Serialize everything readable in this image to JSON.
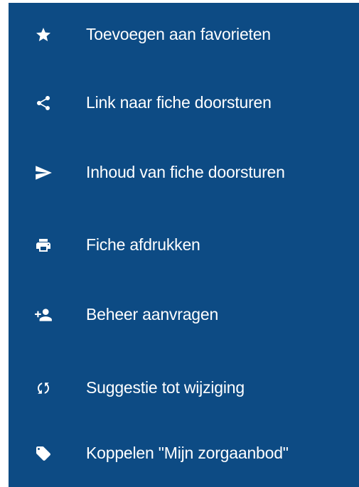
{
  "menu": {
    "background_color": "#0d4b84",
    "text_color": "#ffffff",
    "items": [
      {
        "label": "Toevoegen aan favorieten",
        "icon": "star-icon"
      },
      {
        "label": "Link naar fiche doorsturen",
        "icon": "share-icon"
      },
      {
        "label": "Inhoud van fiche doorsturen",
        "icon": "send-icon"
      },
      {
        "label": "Fiche afdrukken",
        "icon": "print-icon"
      },
      {
        "label": "Beheer aanvragen",
        "icon": "person-add-icon"
      },
      {
        "label": "Suggestie tot wijziging",
        "icon": "sync-icon"
      },
      {
        "label": "Koppelen \"Mijn zorgaanbod\"",
        "icon": "tag-icon"
      }
    ]
  }
}
